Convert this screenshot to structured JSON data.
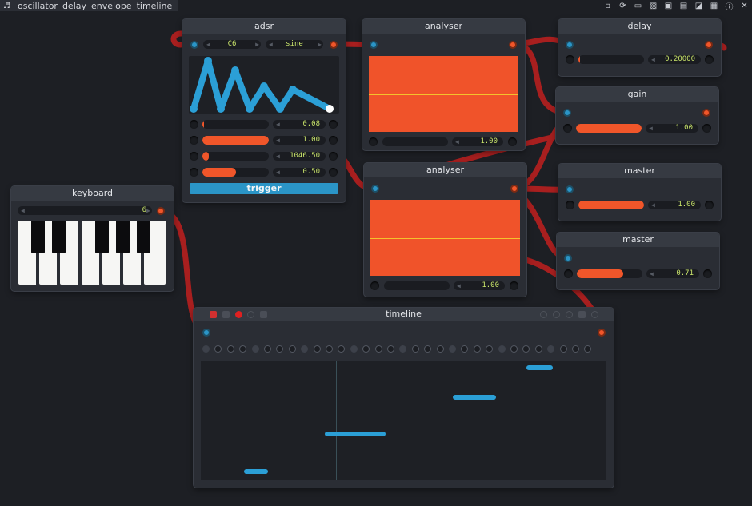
{
  "menubar": {
    "logo": "♬",
    "items": [
      "oscillator",
      "delay",
      "envelope",
      "timeline"
    ]
  },
  "toolbar": {
    "icons": [
      "save-icon",
      "refresh-icon",
      "folder-icon",
      "image-icon",
      "terminal-icon",
      "display-icon",
      "contrast-icon",
      "keyboard-icon",
      "info-icon",
      "close-icon"
    ],
    "glyphs": [
      "▫",
      "⟳",
      "▭",
      "▨",
      "▣",
      "▤",
      "◪",
      "▦",
      "ⓘ",
      "✕"
    ]
  },
  "colors": {
    "accent_blue": "#2b95c7",
    "accent_orange": "#f0562a",
    "wire_red": "#a81f1f",
    "value_green": "#c8e36a",
    "scope_line": "#f3c22d"
  },
  "adsr": {
    "title": "adsr",
    "note_value": "C6",
    "wave_value": "sine",
    "rows": [
      {
        "value": "0.08",
        "fraction": 0.01
      },
      {
        "value": "1.00",
        "fraction": 1.0
      },
      {
        "value": "1046.50",
        "fraction": 0.1
      },
      {
        "value": "0.50",
        "fraction": 0.5
      }
    ],
    "trigger_label": "trigger"
  },
  "analyser1": {
    "title": "analyser",
    "value": "1.00"
  },
  "analyser2": {
    "title": "analyser",
    "value": "1.00"
  },
  "delay": {
    "title": "delay",
    "value": "0.20000",
    "fraction": 0.01
  },
  "gain": {
    "title": "gain",
    "value": "1.00",
    "fraction": 1.0
  },
  "master1": {
    "title": "master",
    "value": "1.00",
    "fraction": 1.0
  },
  "master2": {
    "title": "master",
    "value": "0.71",
    "fraction": 0.71
  },
  "keyboard": {
    "title": "keyboard",
    "value": "6"
  },
  "timeline": {
    "title": "timeline"
  }
}
